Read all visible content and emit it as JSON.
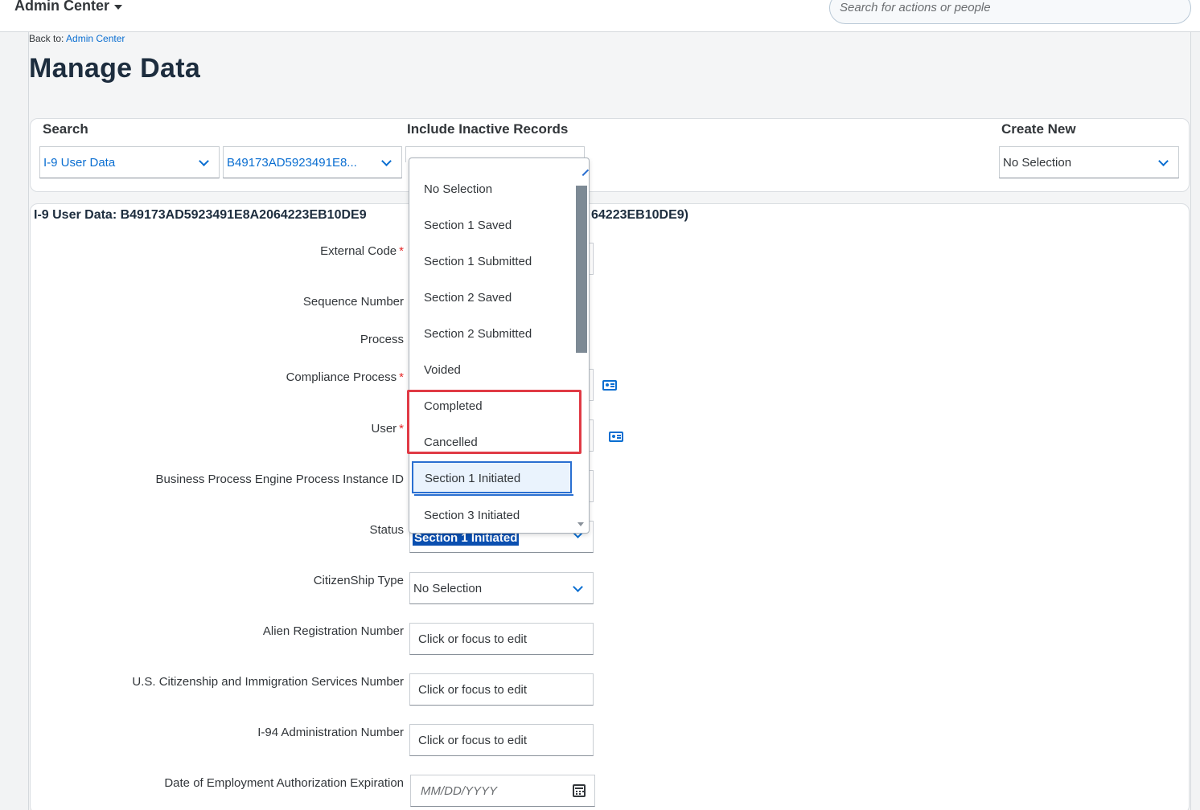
{
  "shell": {
    "title": "Admin Center",
    "search_placeholder": "Search for actions or people"
  },
  "breadcrumb": {
    "prefix": "Back to:",
    "link": "Admin Center"
  },
  "page_title": "Manage Data",
  "search_card": {
    "search_label": "Search",
    "inactive_label": "Include Inactive Records",
    "create_label": "Create New",
    "object_type": "I-9 User Data",
    "record_id": "B49173AD5923491E8...",
    "create_selection": "No Selection"
  },
  "details": {
    "heading": "I-9 User Data: B49173AD5923491E8A2064223EB10DE9",
    "heading_tail": "64223EB10DE9)",
    "fields": {
      "external_code": "External Code",
      "sequence_number": "Sequence Number",
      "process": "Process",
      "compliance_process": "Compliance Process",
      "user": "User",
      "bpe_instance_id": "Business Process Engine Process Instance ID",
      "status": "Status",
      "citizenship_type": "CitizenShip Type",
      "alien_registration": "Alien Registration Number",
      "uscis_number": "U.S. Citizenship and Immigration Services Number",
      "i94_number": "I-94 Administration Number",
      "auth_expiration": "Date of Employment Authorization Expiration"
    },
    "status_value": "Section 1 Initiated",
    "citizenship_value": "No Selection",
    "edit_placeholder": "Click or focus to edit",
    "date_placeholder": "MM/DD/YYYY"
  },
  "status_dropdown": {
    "options": [
      "No Selection",
      "Section 1 Saved",
      "Section 1 Submitted",
      "Section 2 Saved",
      "Section 2 Submitted",
      "Voided",
      "Completed",
      "Cancelled",
      "Section 1 Initiated",
      "Section 3 Initiated"
    ],
    "focused": "Section 1 Initiated"
  },
  "colors": {
    "accent": "#0a6ed1",
    "highlight": "#e03a45",
    "required": "#e52929"
  }
}
